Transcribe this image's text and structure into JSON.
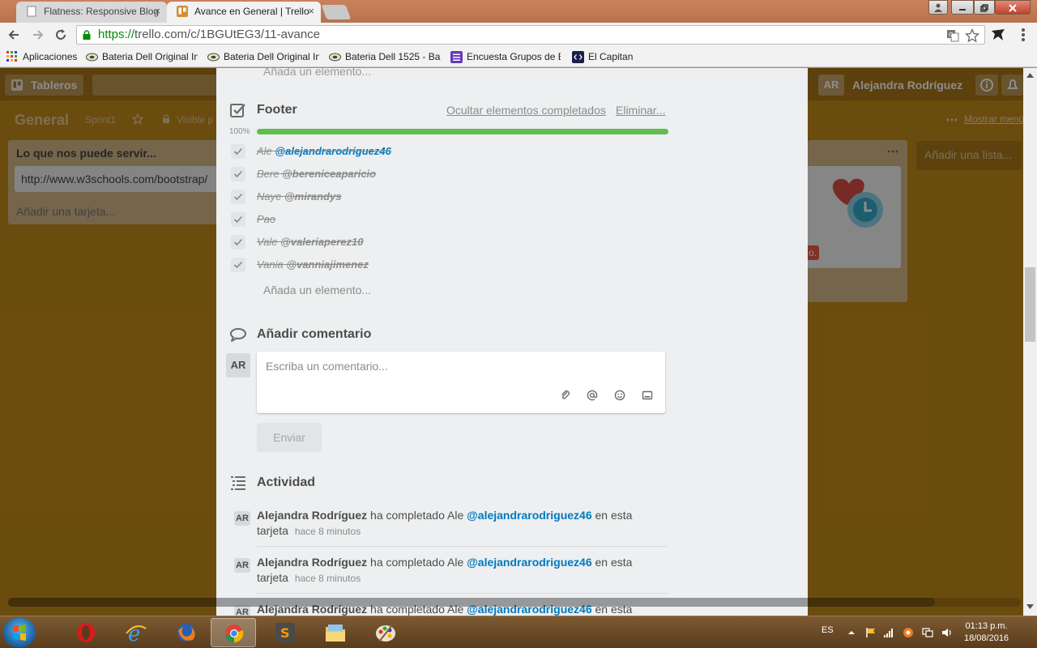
{
  "browser": {
    "tabs": [
      {
        "title": "Flatness: Responsive Blog",
        "active": false
      },
      {
        "title": "Avance en General | Trello",
        "active": true
      }
    ],
    "close_glyph": "×",
    "url_secure_part": "https://",
    "url_rest": "trello.com/c/1BGUtEG3/11-avance",
    "bookmarks": [
      {
        "label": "Aplicaciones",
        "icon": "apps-icon"
      },
      {
        "label": "Bateria Dell Original In",
        "icon": "battery-icon"
      },
      {
        "label": "Bateria Dell Original In",
        "icon": "battery-icon"
      },
      {
        "label": "Bateria Dell 1525 - Ba",
        "icon": "battery-icon"
      },
      {
        "label": "Encuesta Grupos de E",
        "icon": "form-icon"
      },
      {
        "label": "El Capitan",
        "icon": "code-icon"
      }
    ]
  },
  "board": {
    "boards_btn": "Tableros",
    "user_initials": "AR",
    "user_name": "Alejandra Rodríguez",
    "name": "General",
    "sprint": "Sprint1",
    "visibility": "Visible p",
    "show_menu": "Mostrar menú",
    "list_title": "Lo que nos puede servir...",
    "list_card": "http://www.w3schools.com/bootstrap/",
    "list_add_card": "Añadir una tarjeta...",
    "add_list": "Añadir una lista...",
    "badge_fragment": "o."
  },
  "card": {
    "add_item_top": "Añada un elemento...",
    "checklist": {
      "title": "Footer",
      "hide_completed": "Ocultar elementos completados",
      "delete": "Eliminar...",
      "progress_label": "100%",
      "progress": 1.0,
      "items": [
        {
          "name": "Ale",
          "mention": "@alejandrarodriguez46"
        },
        {
          "name": "Bere",
          "mention": "@bereniceaparicio"
        },
        {
          "name": "Naye",
          "mention": "@mirandys"
        },
        {
          "name": "Pao",
          "mention": ""
        },
        {
          "name": "Vale",
          "mention": "@valeriaperez10"
        },
        {
          "name": "Vania",
          "mention": "@vanniajimenez"
        }
      ],
      "add_item": "Añada un elemento..."
    },
    "comment": {
      "title": "Añadir comentario",
      "avatar": "AR",
      "placeholder": "Escriba un comentario...",
      "send": "Enviar"
    },
    "activity": {
      "title": "Actividad",
      "entries": [
        {
          "avatar": "AR",
          "actor": "Alejandra Rodríguez",
          "verb": "ha completado Ale",
          "mention": "@alejandrarodriguez46",
          "tail": "en esta tarjeta",
          "when": "hace 8 minutos"
        },
        {
          "avatar": "AR",
          "actor": "Alejandra Rodríguez",
          "verb": "ha completado Ale",
          "mention": "@alejandrarodriguez46",
          "tail": "en esta tarjeta",
          "when": "hace 8 minutos"
        },
        {
          "avatar": "AR",
          "actor": "Alejandra Rodríguez",
          "verb": "ha completado Ale",
          "mention": "@alejandrarodriguez46",
          "tail": "en esta",
          "when": ""
        }
      ]
    }
  },
  "taskbar": {
    "lang": "ES",
    "time": "01:13 p.m.",
    "date": "18/08/2016"
  },
  "colors": {
    "board_bg": "#c48a1c",
    "progress_green": "#61bd4f",
    "mention_blue": "#0079bf"
  }
}
